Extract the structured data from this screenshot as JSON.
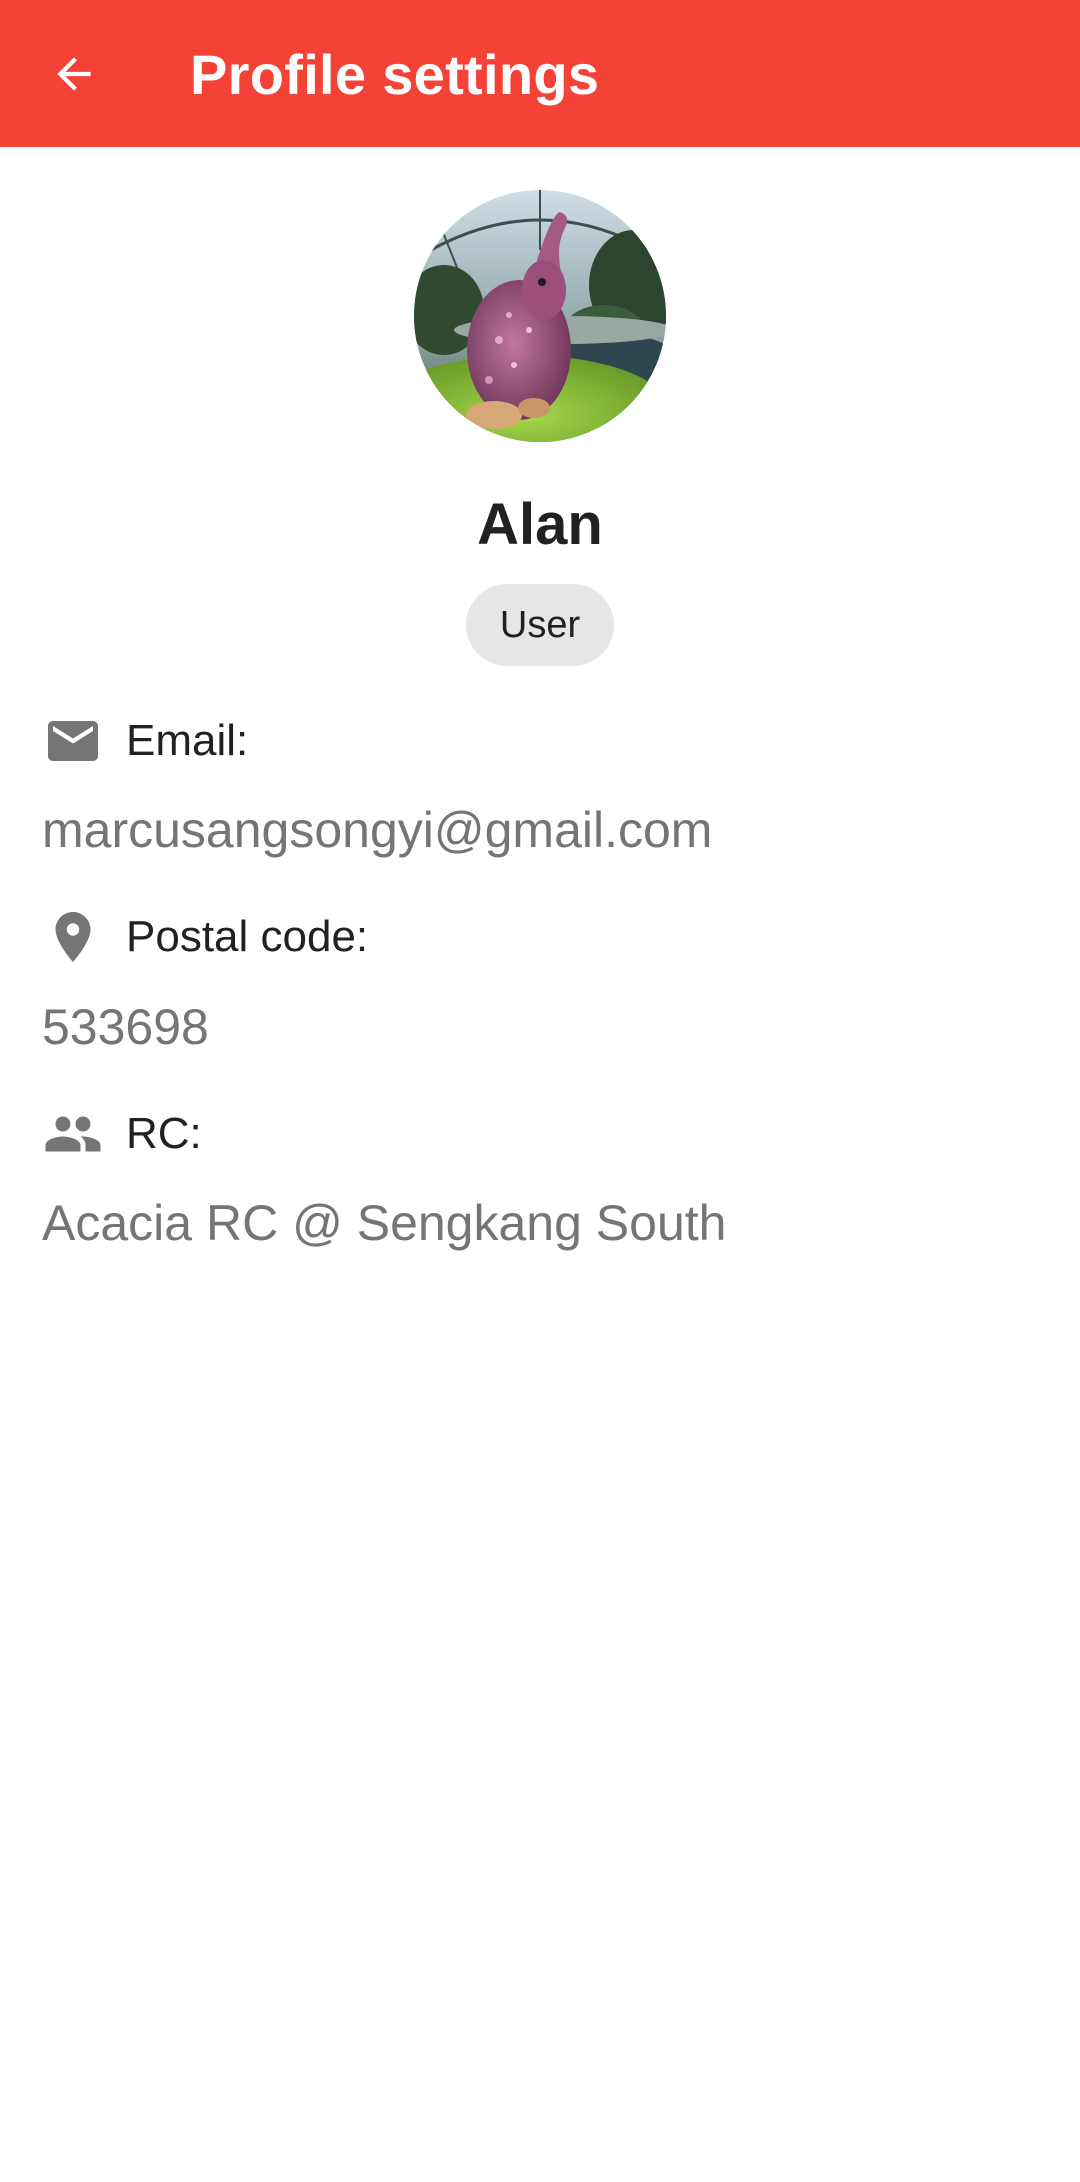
{
  "appbar": {
    "title": "Profile settings",
    "back_icon": "arrow-back-icon",
    "color": "#f44336"
  },
  "profile": {
    "avatar_icon": "profile-photo-avatar",
    "name": "Alan",
    "role": "User"
  },
  "fields": {
    "email": {
      "icon": "mail-icon",
      "label": "Email:",
      "value": "marcusangsongyi@gmail.com"
    },
    "postal": {
      "icon": "location-pin-icon",
      "label": "Postal code:",
      "value": "533698"
    },
    "rc": {
      "icon": "people-icon",
      "label": "RC:",
      "value": "Acacia RC @ Sengkang South"
    }
  }
}
